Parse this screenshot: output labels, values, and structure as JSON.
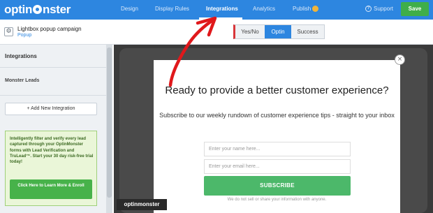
{
  "topbar": {
    "logo_pre": "optin",
    "logo_post": "nster",
    "nav": [
      "Design",
      "Display Rules",
      "Integrations",
      "Analytics",
      "Publish"
    ],
    "support": "Support",
    "save": "Save"
  },
  "campaign": {
    "title": "Lightbox popup campaign",
    "type": "Popup",
    "settings_icon": "gear-icon"
  },
  "views": [
    "Yes/No",
    "Optin",
    "Success"
  ],
  "sidebar": {
    "header": "Integrations",
    "section": "Monster Leads",
    "add_button": "+ Add New Integration",
    "promo_text": "Intelligently filter and verify every lead captured through your OptinMonster forms with Lead Verification and TruLead™. Start your 30 day risk-free trial today!",
    "promo_button": "Click Here to Learn More & Enroll"
  },
  "popup": {
    "title": "Ready to provide a better customer experience?",
    "subtitle": "Subscribe to our weekly rundown of customer experience tips - straight to your inbox",
    "name_placeholder": "Enter your name here...",
    "email_placeholder": "Enter your email here...",
    "button": "SUBSCRIBE",
    "fine_print": "We do not sell or share your information with anyone.",
    "close": "×"
  },
  "badge": "optinmonster",
  "colors": {
    "brand_blue": "#2d86e0",
    "save_green": "#3fae49",
    "subscribe_green": "#4cb86a",
    "arrow_red": "#e0181b"
  }
}
